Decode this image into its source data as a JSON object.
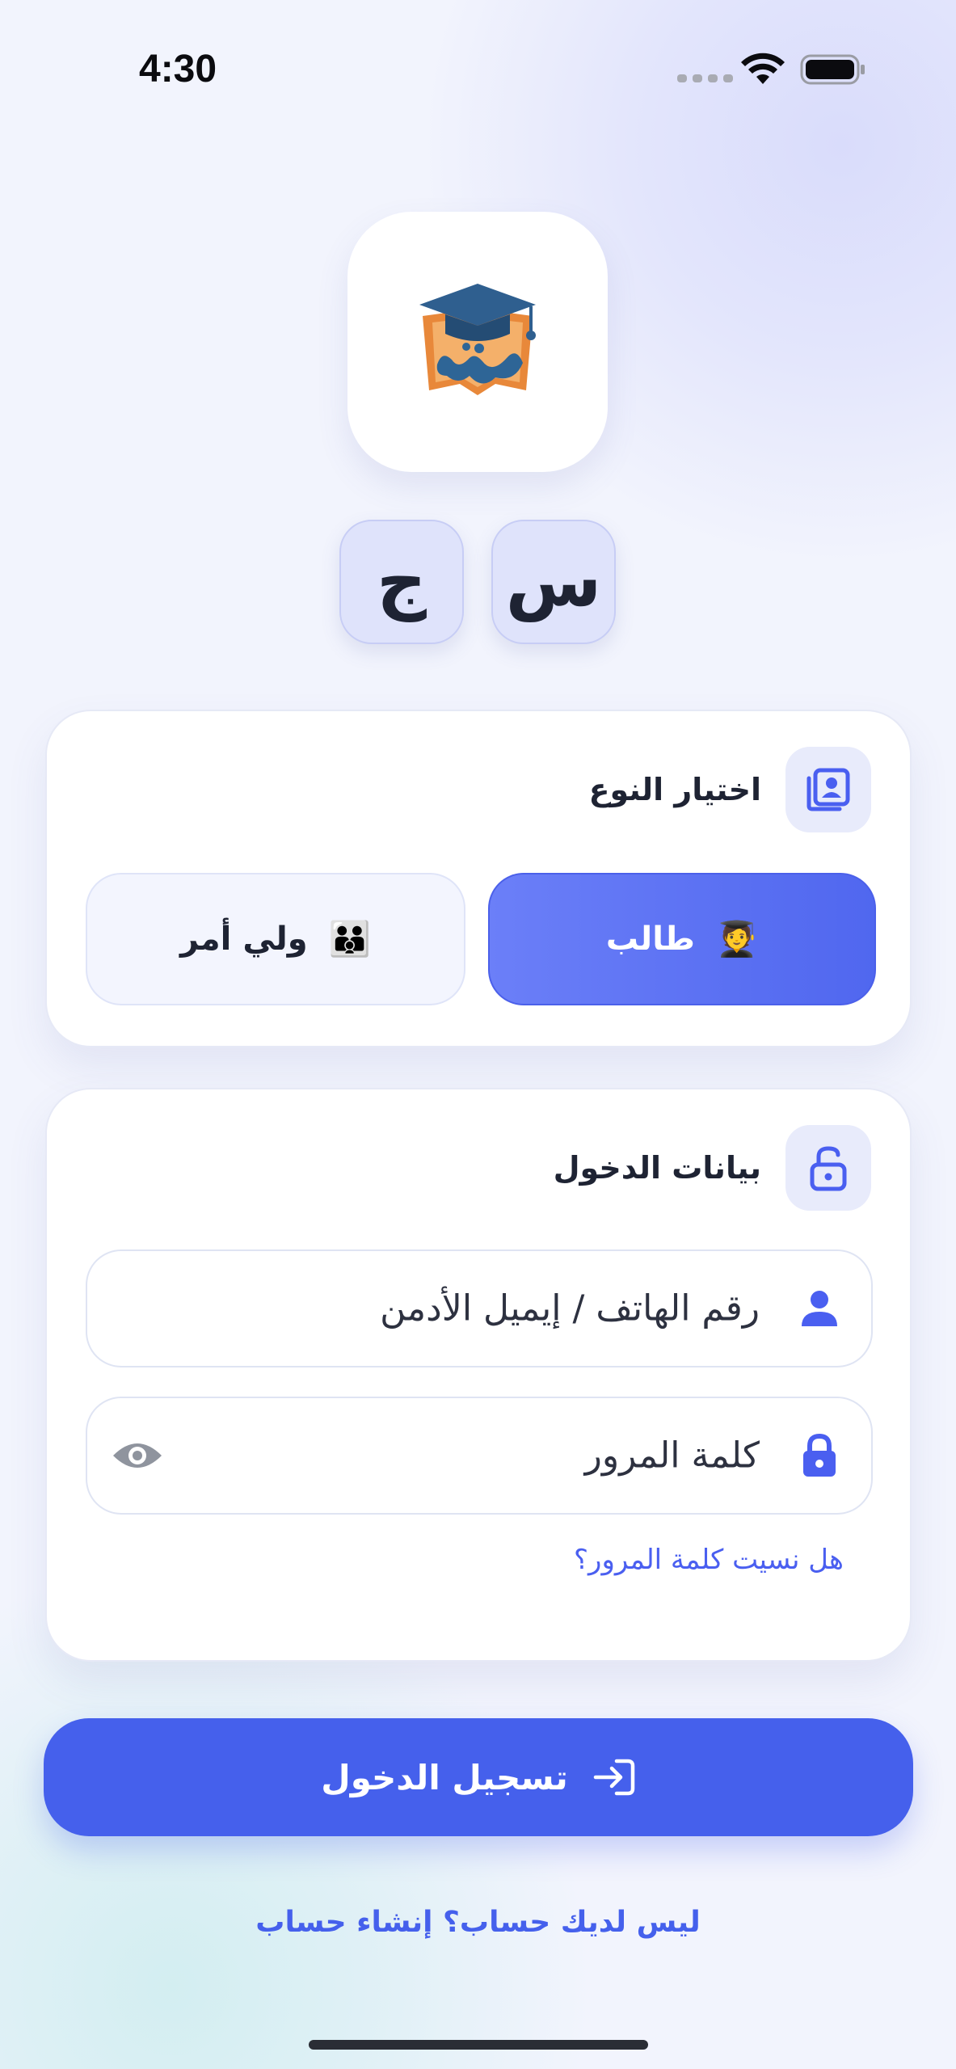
{
  "status_bar": {
    "time": "4:30"
  },
  "letters": {
    "first": "س",
    "second": "ج"
  },
  "type_card": {
    "title": "اختيار النوع",
    "options": [
      {
        "label": "طالب",
        "emoji": "🧑‍🎓",
        "selected": true
      },
      {
        "label": "ولي أمر",
        "emoji": "👪",
        "selected": false
      }
    ]
  },
  "login_card": {
    "title": "بيانات الدخول",
    "username_placeholder": "رقم الهاتف / إيميل الأدمن",
    "password_placeholder": "كلمة المرور",
    "forgot_link": "هل نسيت كلمة المرور؟"
  },
  "actions": {
    "login_button": "تسجيل الدخول",
    "signup_link": "ليس لديك حساب؟ إنشاء حساب"
  },
  "colors": {
    "accent": "#4560ec",
    "selected_gradient_start": "#6b7ff8",
    "tile_bg": "#dfe3fb"
  },
  "icons": [
    "wifi-icon",
    "battery-icon",
    "app-logo",
    "profile-card-icon",
    "lock-open-icon",
    "user-icon",
    "lock-icon",
    "eye-icon",
    "login-arrow-icon"
  ]
}
